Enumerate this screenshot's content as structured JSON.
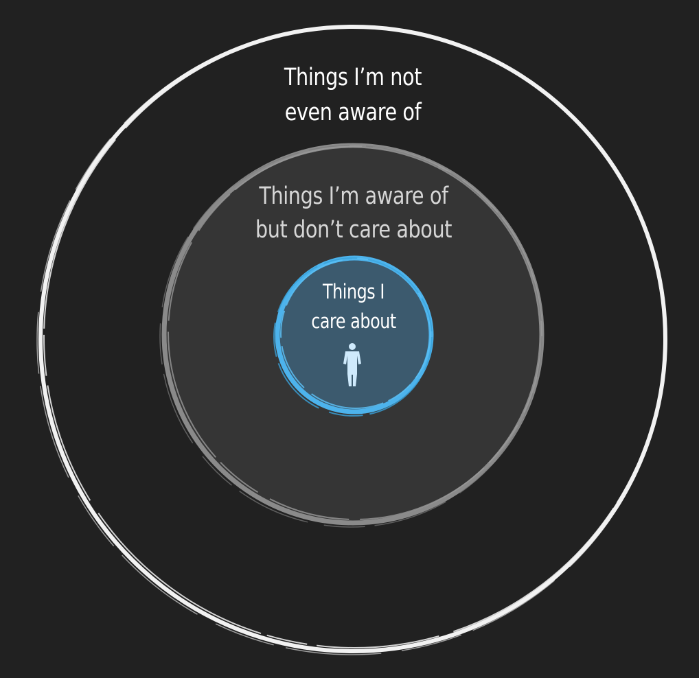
{
  "diagram": {
    "background": "#212121",
    "circles": [
      {
        "id": "outer",
        "label_lines": [
          "Things I’m not",
          "even aware of"
        ],
        "fill": "#212121",
        "stroke": "#f2f2f2",
        "text_color": "#ffffff"
      },
      {
        "id": "middle",
        "label_lines": [
          "Things I’m aware of",
          "but don’t care about"
        ],
        "fill": "#353535",
        "stroke": "#8a8a8a",
        "text_color": "#d6d6d6"
      },
      {
        "id": "inner",
        "label_lines": [
          "Things I",
          "care about"
        ],
        "fill": "#3c5a6e",
        "stroke": "#4db3ec",
        "text_color": "#ffffff"
      }
    ],
    "figure": {
      "icon": "person-silhouette-icon",
      "color": "#cfeafc"
    }
  }
}
